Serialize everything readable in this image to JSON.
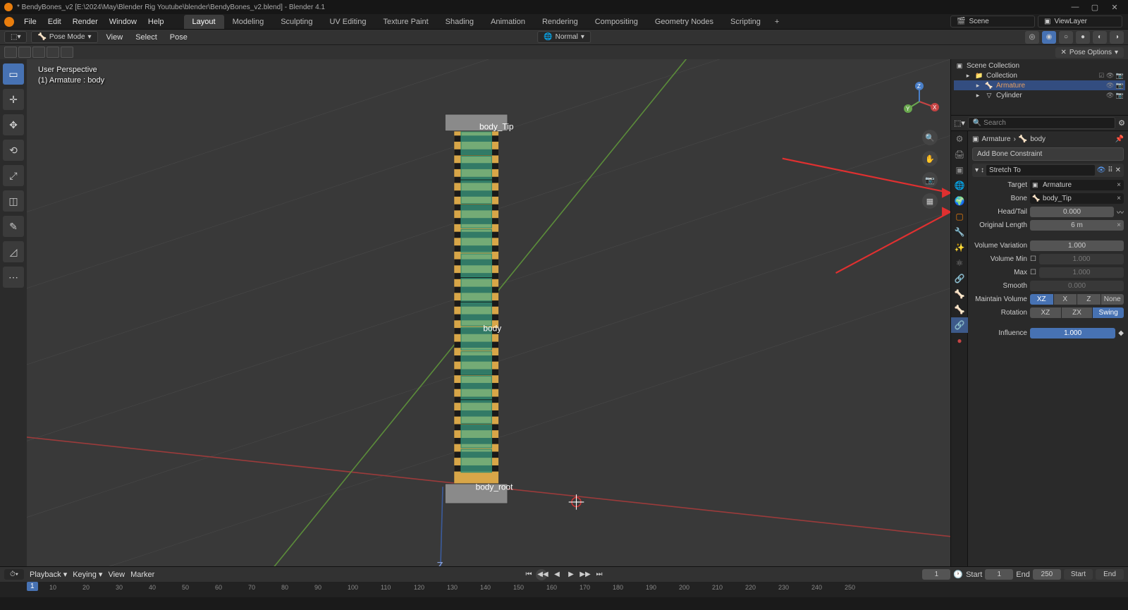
{
  "title": "* BendyBones_v2 [E:\\2024\\May\\Blender Rig Youtube\\blender\\BendyBones_v2.blend] - Blender 4.1",
  "menu": {
    "items": [
      "File",
      "Edit",
      "Render",
      "Window",
      "Help"
    ]
  },
  "workspace_tabs": [
    "Layout",
    "Modeling",
    "Sculpting",
    "UV Editing",
    "Texture Paint",
    "Shading",
    "Animation",
    "Rendering",
    "Compositing",
    "Geometry Nodes",
    "Scripting"
  ],
  "workspace_active": "Layout",
  "scene_field": "Scene",
  "viewlayer_field": "ViewLayer",
  "header": {
    "mode": "Pose Mode",
    "menus": [
      "View",
      "Select",
      "Pose"
    ],
    "pivot": "Normal"
  },
  "pose_options": "Pose Options",
  "viewport_info": {
    "l1": "User Perspective",
    "l2": "(1) Armature : body"
  },
  "bone_labels": {
    "tip": "body_Tip",
    "body": "body",
    "root": "body_root"
  },
  "outliner": {
    "root": "Scene Collection",
    "collection": "Collection",
    "items": [
      "Armature",
      "Cylinder"
    ]
  },
  "props_search_placeholder": "Search",
  "crumb": {
    "a": "Armature",
    "b": "body"
  },
  "add_constraint": "Add Bone Constraint",
  "constraint": {
    "name": "Stretch To",
    "target_label": "Target",
    "target_value": "Armature",
    "bone_label": "Bone",
    "bone_value": "body_Tip",
    "headtail_label": "Head/Tail",
    "headtail_value": "0.000",
    "origlen_label": "Original Length",
    "origlen_value": "6 m",
    "volvar_label": "Volume Variation",
    "volvar_value": "1.000",
    "volmin_label": "Volume Min",
    "volmin_value": "1.000",
    "volmax_label": "Max",
    "volmax_value": "1.000",
    "smooth_label": "Smooth",
    "smooth_value": "0.000",
    "maintain_label": "Maintain Volume",
    "maintain_opts": [
      "XZ",
      "X",
      "Z",
      "None"
    ],
    "rotation_label": "Rotation",
    "rotation_opts": [
      "XZ",
      "ZX",
      "Swing"
    ],
    "influence_label": "Influence",
    "influence_value": "1.000"
  },
  "timeline": {
    "playback": "Playback",
    "keying": "Keying",
    "view": "View",
    "marker": "Marker",
    "current": "1",
    "start_label": "Start",
    "start": "1",
    "end_label": "End",
    "end": "250",
    "start2": "Start",
    "end2": "End",
    "ticks": [
      10,
      20,
      30,
      40,
      50,
      60,
      70,
      80,
      90,
      100,
      110,
      120,
      130,
      140,
      150,
      160,
      170,
      180,
      190,
      200,
      210,
      220,
      230,
      240,
      250
    ],
    "cursor": "1"
  },
  "status": {
    "left": "",
    "right": ""
  }
}
